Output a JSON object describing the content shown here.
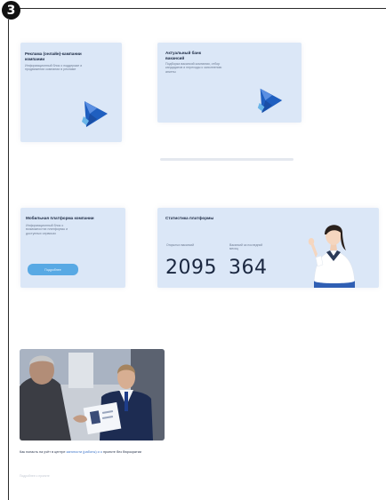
{
  "step_number": "3",
  "cards": {
    "card1": {
      "title": "Реклама (онлайн)-кампании компании",
      "desc": "Информационный блок о поддержке и продвижении компании в рекламе"
    },
    "card2": {
      "title": "Актуальный банк вакансий",
      "desc": "Подборка вакансий компании, отбор кандидатов и переходы к заполнению анкеты"
    },
    "card3": {
      "title": "Мобильная платформа компании",
      "desc": "Информационный блок о возможностях платформы и доступных сервисах",
      "button_label": "Подробнее"
    },
    "stats": {
      "title": "Статистика платформы",
      "stat1_label": "Открытых вакансий",
      "stat1_value": "2095",
      "stat2_label": "Вакансий за последний месяц",
      "stat2_value": "364"
    }
  },
  "news": {
    "caption_prefix": "Как попасть на учёт в центре ",
    "caption_link": "занятости (работы) и о",
    "caption_suffix": " проекте без бюрократии",
    "caption_faint": "Подробнее о проекте"
  },
  "colors": {
    "card_bg": "#dbe7f7",
    "accent_blue": "#58a9e4",
    "logo_blue": "#1f5fc0"
  }
}
